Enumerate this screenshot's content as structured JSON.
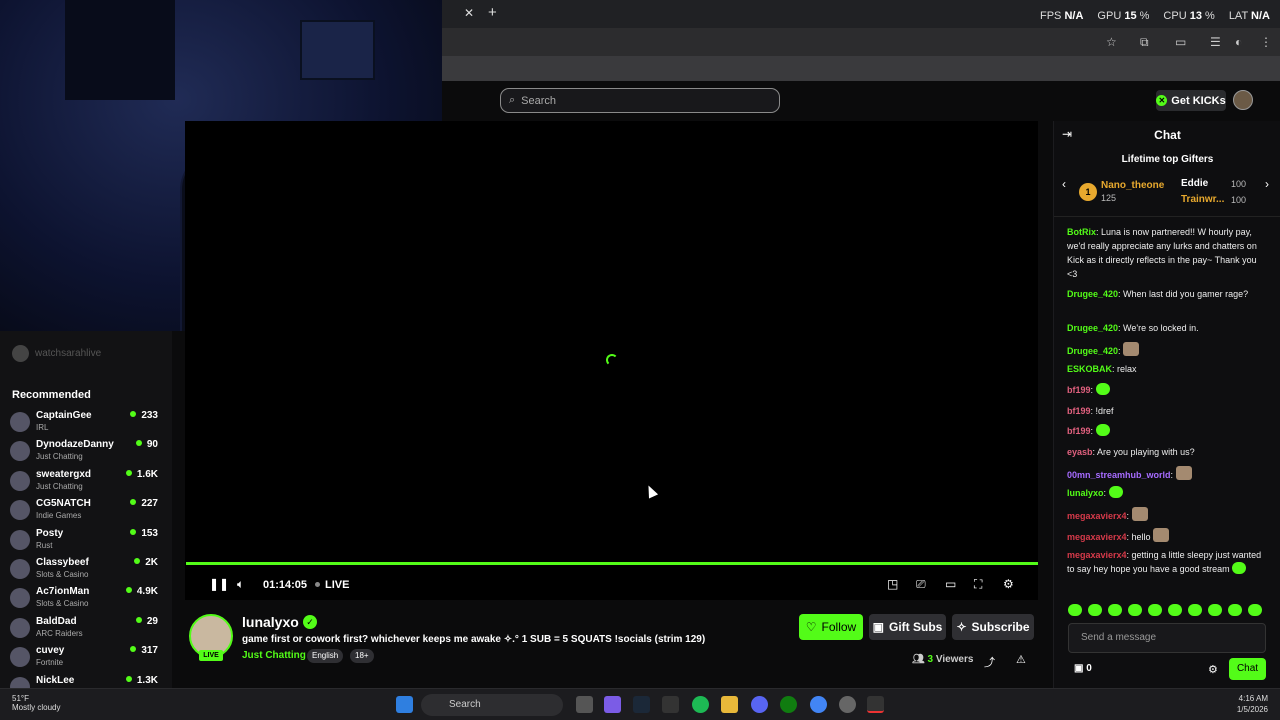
{
  "overlay": {
    "fps_label": "FPS",
    "fps_value": "N/A",
    "gpu_label": "GPU",
    "gpu_value": "15",
    "cpu_label": "CPU",
    "cpu_value": "13",
    "lat_label": "LAT",
    "lat_value": "N/A"
  },
  "header": {
    "search_placeholder": "Search",
    "get_kicks_label": "Get KICKs"
  },
  "sidebar": {
    "pinned_channel": "watchsarahlive",
    "recommended_heading": "Recommended",
    "channels": [
      {
        "name": "CaptainGee",
        "category": "IRL",
        "viewers": "233"
      },
      {
        "name": "DynodazeDanny",
        "category": "Just Chatting",
        "viewers": "90"
      },
      {
        "name": "sweatergxd",
        "category": "Just Chatting",
        "viewers": "1.6K"
      },
      {
        "name": "CG5NATCH",
        "category": "Indie Games",
        "viewers": "227"
      },
      {
        "name": "Posty",
        "category": "Rust",
        "viewers": "153"
      },
      {
        "name": "Classybeef",
        "category": "Slots & Casino",
        "viewers": "2K"
      },
      {
        "name": "Ac7ionMan",
        "category": "Slots & Casino",
        "viewers": "4.9K"
      },
      {
        "name": "BaldDad",
        "category": "ARC Raiders",
        "viewers": "29"
      },
      {
        "name": "cuvey",
        "category": "Fortnite",
        "viewers": "317"
      },
      {
        "name": "NickLee",
        "category": "",
        "viewers": "1.3K"
      }
    ]
  },
  "player": {
    "timecode": "01:14:05",
    "live_label": "LIVE"
  },
  "stream": {
    "live_tag": "LIVE",
    "streamer_name": "lunalyxo",
    "title": "game first or cowork first? whichever keeps me awake ✧.° 1 SUB = 5 SQUATS !socials (strim 129)",
    "category": "Just Chatting",
    "tags": [
      "English",
      "18+"
    ],
    "follow_label": "Follow",
    "gift_subs_label": "Gift Subs",
    "subscribe_label": "Subscribe",
    "viewer_count": "3",
    "viewers_label": "Viewers"
  },
  "chat": {
    "title": "Chat",
    "gifters_title": "Lifetime top Gifters",
    "gifters": [
      {
        "rank": "1",
        "name": "Nano_theone",
        "amount": "125"
      },
      {
        "name": "Eddie",
        "amount": "100"
      },
      {
        "name": "Trainwr...",
        "amount": "100"
      }
    ],
    "messages": [
      {
        "user": "BotRix",
        "color": "#53fc18",
        "text": ": Luna is now partnered!! W hourly pay, we'd really appreciate any lurks and chatters on Kick as it directly reflects in the pay~ Thank you <3"
      },
      {
        "user": "Drugee_420",
        "color": "#53fc18",
        "text": ": When last did you gamer rage?"
      },
      {
        "user": "Drugee_420",
        "color": "#53fc18",
        "text": ": We're so locked in."
      },
      {
        "user": "Drugee_420",
        "color": "#53fc18",
        "text": ":"
      },
      {
        "user": "ESKOBAK",
        "color": "#53fc18",
        "text": ": relax"
      },
      {
        "user": "bf199",
        "color": "#e0607e",
        "text": ":"
      },
      {
        "user": "bf199",
        "color": "#e0607e",
        "text": ": !dref"
      },
      {
        "user": "bf199",
        "color": "#e0607e",
        "text": ":"
      },
      {
        "user": "eyasb",
        "color": "#e0607e",
        "text": ": Are you playing with us?"
      },
      {
        "user": "00mn_streamhub_world",
        "color": "#a66bff",
        "text": ":"
      },
      {
        "user": "lunalyxo",
        "color": "#53fc18",
        "text": ":"
      },
      {
        "user": "megaxavierx4",
        "color": "#d63a4a",
        "text": ":"
      },
      {
        "user": "megaxavierx4",
        "color": "#d63a4a",
        "text": ": hello"
      },
      {
        "user": "megaxavierx4",
        "color": "#d63a4a",
        "text": ": getting a little sleepy just wanted to say hey hope you have a good stream"
      }
    ],
    "send_placeholder": "Send a message",
    "kicks_count": "0",
    "chat_button": "Chat"
  },
  "taskbar": {
    "temperature": "51°F",
    "weather": "Mostly cloudy",
    "search_label": "Search",
    "time": "4:16 AM",
    "date": "1/5/2026"
  }
}
